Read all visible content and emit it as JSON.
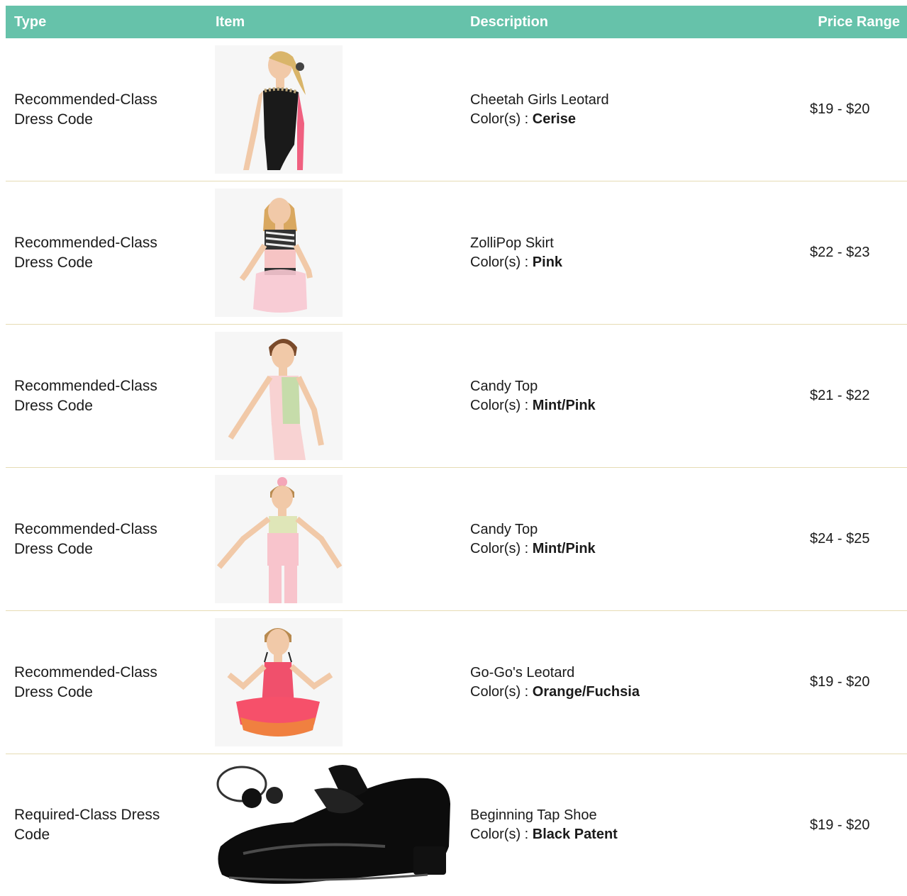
{
  "header": {
    "type": "Type",
    "item": "Item",
    "description": "Description",
    "price": "Price Range"
  },
  "color_prefix": "Color(s) : ",
  "rows": [
    {
      "type": "Recommended-Class Dress Code",
      "name": "Cheetah Girls Leotard",
      "color": "Cerise",
      "price": "$19 - $20",
      "image_icon": "girl-black-leotard-image"
    },
    {
      "type": "Recommended-Class Dress Code",
      "name": "ZolliPop Skirt",
      "color": "Pink",
      "price": "$22 - $23",
      "image_icon": "girl-zebra-skirt-image"
    },
    {
      "type": "Recommended-Class Dress Code",
      "name": "Candy Top",
      "color": "Mint/Pink",
      "price": "$21 - $22",
      "image_icon": "girl-mint-top-image"
    },
    {
      "type": "Recommended-Class Dress Code",
      "name": "Candy Top",
      "color": "Mint/Pink",
      "price": "$24 - $25",
      "image_icon": "girl-mint-pink-pants-image"
    },
    {
      "type": "Recommended-Class Dress Code",
      "name": "Go-Go's Leotard",
      "color": "Orange/Fuchsia",
      "price": "$19 - $20",
      "image_icon": "girl-pink-tutu-image"
    },
    {
      "type": "Required-Class Dress Code",
      "name": "Beginning Tap Shoe",
      "color": "Black Patent",
      "price": "$19 - $20",
      "image_icon": "black-tap-shoe-image"
    }
  ],
  "colors": {
    "header_bg": "#66c2aa",
    "row_divider": "#e6dcb4"
  }
}
